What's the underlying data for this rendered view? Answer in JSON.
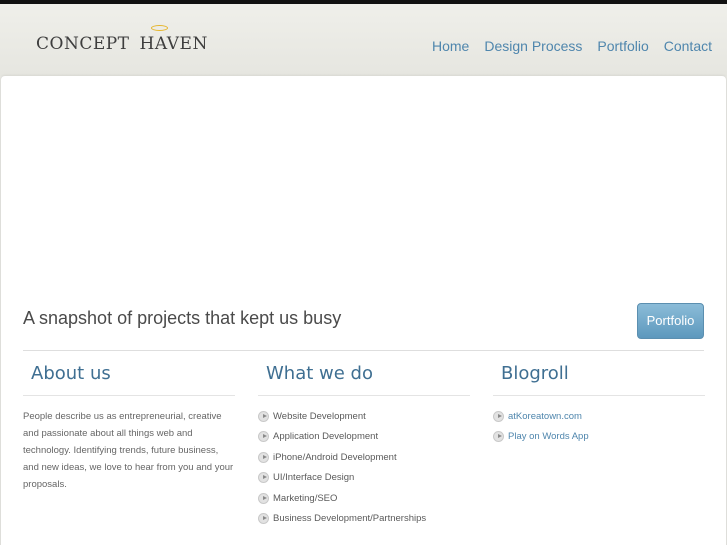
{
  "brand": {
    "word1": "CONCEPT",
    "word2": "HAVEN",
    "halo_color": "#e5b52b"
  },
  "nav": {
    "items": [
      {
        "label": "Home"
      },
      {
        "label": "Design Process"
      },
      {
        "label": "Portfolio"
      },
      {
        "label": "Contact"
      }
    ]
  },
  "hero": {
    "tagline": "A snapshot of projects that kept us busy",
    "button_label": "Portfolio"
  },
  "about": {
    "title": "About us",
    "text": "People describe us as entrepreneurial, creative and passionate about all things web and technology. Identifying trends, future business, and new ideas, we love to hear from you and your proposals."
  },
  "services": {
    "title": "What we do",
    "items": [
      "Website Development",
      "Application Development",
      "iPhone/Android Development",
      "UI/Interface Design",
      "Marketing/SEO",
      "Business Development/Partnerships"
    ]
  },
  "blogroll": {
    "title": "Blogroll",
    "items": [
      "atKoreatown.com",
      "Play on Words App"
    ]
  },
  "colors": {
    "accent": "#4f86ad",
    "heading": "#3f6f92",
    "button": "#6aa3c6"
  }
}
